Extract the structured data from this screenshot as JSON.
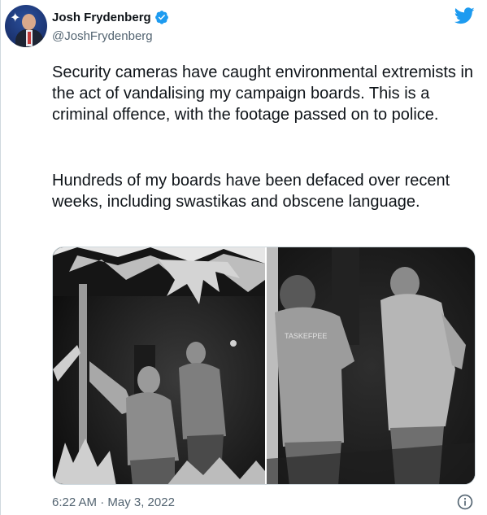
{
  "tweet": {
    "author_name": "Josh Frydenberg",
    "author_handle": "@JoshFrydenberg",
    "paragraph_1": "Security cameras have caught environmental extremists in the act of vandalising my campaign boards. This is a criminal offence, with the footage passed on to police.",
    "paragraph_2": "Hundreds of my boards have been defaced over recent weeks, including swastikas and obscene language.",
    "timestamp": "6:22 AM · May 3, 2022",
    "media": [
      {
        "kind": "security-camera-photo",
        "printed_text": ""
      },
      {
        "kind": "security-camera-photo",
        "printed_text": "TASKEFPEE"
      }
    ]
  },
  "icons": {
    "verified": "verified-badge-icon",
    "twitter": "twitter-bird-icon",
    "info": "info-icon"
  },
  "colors": {
    "twitter_blue": "#1d9bf0",
    "text_primary": "#0f1419",
    "text_secondary": "#536471",
    "border": "#cfd9de"
  }
}
